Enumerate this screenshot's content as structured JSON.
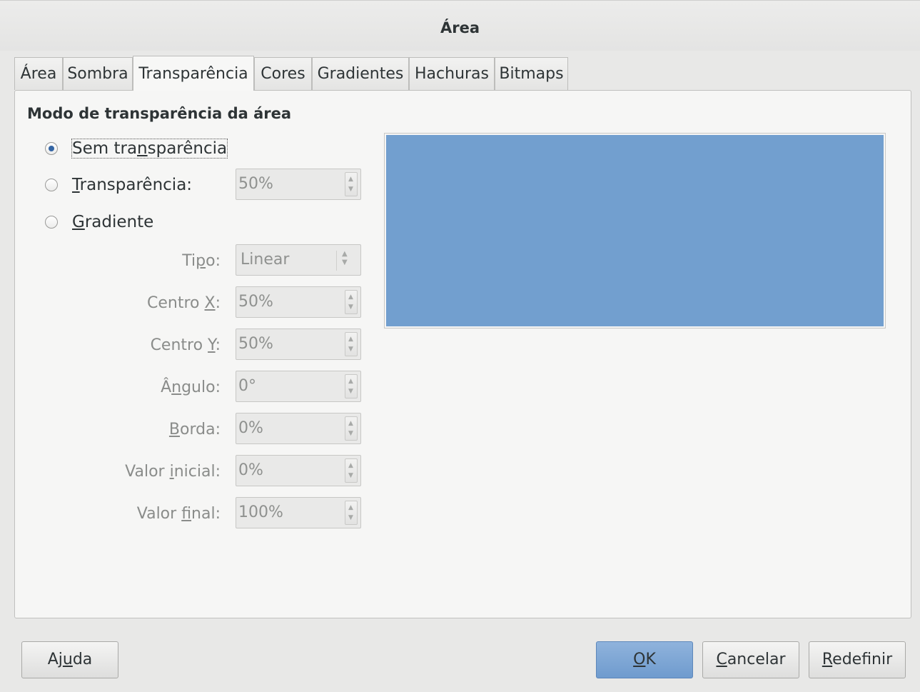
{
  "window": {
    "title": "Área"
  },
  "tabs": [
    {
      "label": "Área"
    },
    {
      "label": "Sombra"
    },
    {
      "label": "Transparência",
      "active": true
    },
    {
      "label": "Cores"
    },
    {
      "label": "Gradientes"
    },
    {
      "label": "Hachuras"
    },
    {
      "label": "Bitmaps"
    }
  ],
  "section_title": "Modo de transparência da área",
  "radio_options": {
    "none": {
      "pre": "Sem tra",
      "mnemonic": "n",
      "post": "sparência",
      "checked": true
    },
    "transparency": {
      "pre": "",
      "mnemonic": "T",
      "post": "ransparência:",
      "checked": false
    },
    "gradient": {
      "pre": "",
      "mnemonic": "G",
      "post": "radiente",
      "checked": false
    }
  },
  "transparency_value": "50%",
  "gradient_fields": {
    "type": {
      "pre": "Ti",
      "mnemonic": "p",
      "post": "o:",
      "value": "Linear"
    },
    "center_x": {
      "pre": "Centro ",
      "mnemonic": "X",
      "post": ":",
      "value": "50%"
    },
    "center_y": {
      "pre": "Centro ",
      "mnemonic": "Y",
      "post": ":",
      "value": "50%"
    },
    "angle": {
      "pre": "Â",
      "mnemonic": "n",
      "post": "gulo:",
      "value": "0°"
    },
    "border": {
      "pre": "",
      "mnemonic": "B",
      "post": "orda:",
      "value": "0%"
    },
    "start_value": {
      "pre": "Valor ",
      "mnemonic": "i",
      "post": "nicial:",
      "value": "0%"
    },
    "end_value": {
      "pre": "Valor ",
      "mnemonic": "f",
      "post": "inal:",
      "value": "100%"
    }
  },
  "preview_color": "#729fcf",
  "buttons": {
    "help": {
      "pre": "Aj",
      "mnemonic": "u",
      "post": "da"
    },
    "ok": {
      "pre": "",
      "mnemonic": "O",
      "post": "K"
    },
    "cancel": {
      "pre": "",
      "mnemonic": "C",
      "post": "ancelar"
    },
    "reset": {
      "pre": "",
      "mnemonic": "R",
      "post": "edefinir"
    }
  }
}
